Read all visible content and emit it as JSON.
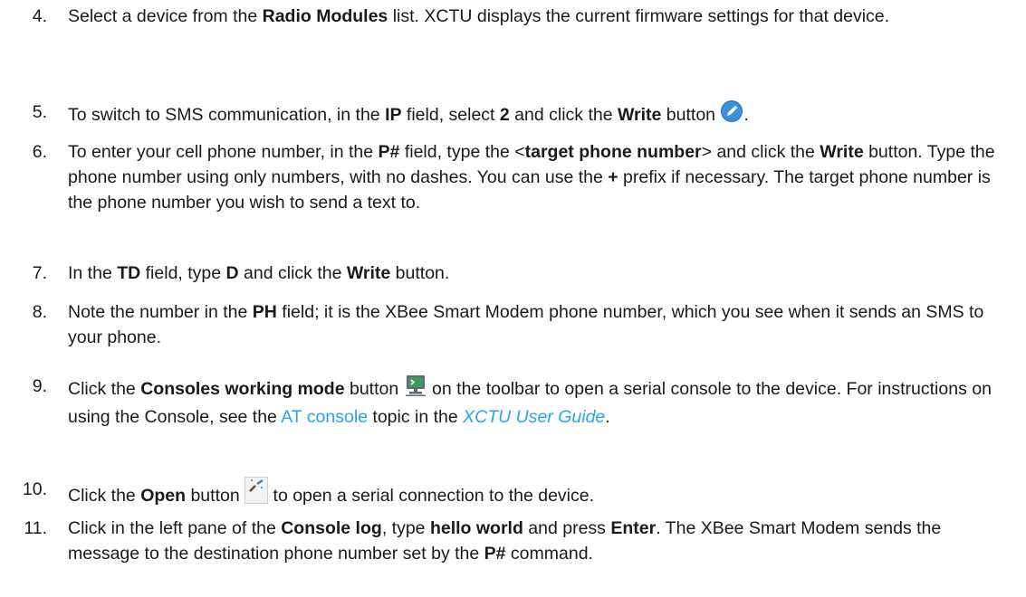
{
  "steps": [
    {
      "number": "4.",
      "parts": [
        {
          "t": "Select a device from the "
        },
        {
          "b": "Radio Modules"
        },
        {
          "t": " list. XCTU displays the current firmware settings for that device."
        }
      ]
    },
    {
      "number": "5.",
      "parts": [
        {
          "t": "To switch to SMS communication, in the "
        },
        {
          "b": "IP"
        },
        {
          "t": " field, select "
        },
        {
          "b": "2"
        },
        {
          "t": " and click the "
        },
        {
          "b": "Write"
        },
        {
          "t": " button "
        },
        {
          "icon": "write-pencil-icon"
        },
        {
          "t": "."
        }
      ]
    },
    {
      "number": "6.",
      "parts": [
        {
          "t": "To enter your cell phone number, in the "
        },
        {
          "b": "P#"
        },
        {
          "t": " field, type the <"
        },
        {
          "b": "target phone number"
        },
        {
          "t": "> and click the "
        },
        {
          "b": "Write"
        },
        {
          "t": " button. Type the phone number using only numbers, with no dashes. You can use the "
        },
        {
          "b": "+"
        },
        {
          "t": " prefix if necessary. The target phone number is the phone number you wish to send a text to."
        }
      ]
    },
    {
      "number": "7.",
      "parts": [
        {
          "t": "In the "
        },
        {
          "b": "TD"
        },
        {
          "t": " field, type "
        },
        {
          "b": "D"
        },
        {
          "t": " and click the "
        },
        {
          "b": "Write"
        },
        {
          "t": " button."
        }
      ]
    },
    {
      "number": "8.",
      "parts": [
        {
          "t": "Note the number in the "
        },
        {
          "b": "PH"
        },
        {
          "t": " field; it is the XBee Smart Modem phone number, which you see when it sends an SMS to your phone."
        }
      ]
    },
    {
      "number": "9.",
      "parts": [
        {
          "t": "Click the "
        },
        {
          "b": "Consoles working mode"
        },
        {
          "t": " button "
        },
        {
          "icon": "console-monitor-icon"
        },
        {
          "t": " on the toolbar to open a serial console to the device. For instructions on using the Console, see the "
        },
        {
          "link": "AT console"
        },
        {
          "t": " topic in the "
        },
        {
          "link_i": "XCTU User Guide"
        },
        {
          "t": "."
        }
      ]
    },
    {
      "number": "10.",
      "parts": [
        {
          "t": "Click the "
        },
        {
          "b": "Open"
        },
        {
          "t": " button "
        },
        {
          "icon": "open-connection-icon",
          "caption": "Open"
        },
        {
          "t": " to open a serial connection to the device."
        }
      ]
    },
    {
      "number": "11.",
      "parts": [
        {
          "t": "Click in the left pane of the "
        },
        {
          "b": "Console log"
        },
        {
          "t": ", type "
        },
        {
          "b": "hello world"
        },
        {
          "t": " and press "
        },
        {
          "b": "Enter"
        },
        {
          "t": ". The XBee Smart Modem sends the message to the destination phone number set by the "
        },
        {
          "b": "P#"
        },
        {
          "t": " command."
        }
      ]
    }
  ]
}
